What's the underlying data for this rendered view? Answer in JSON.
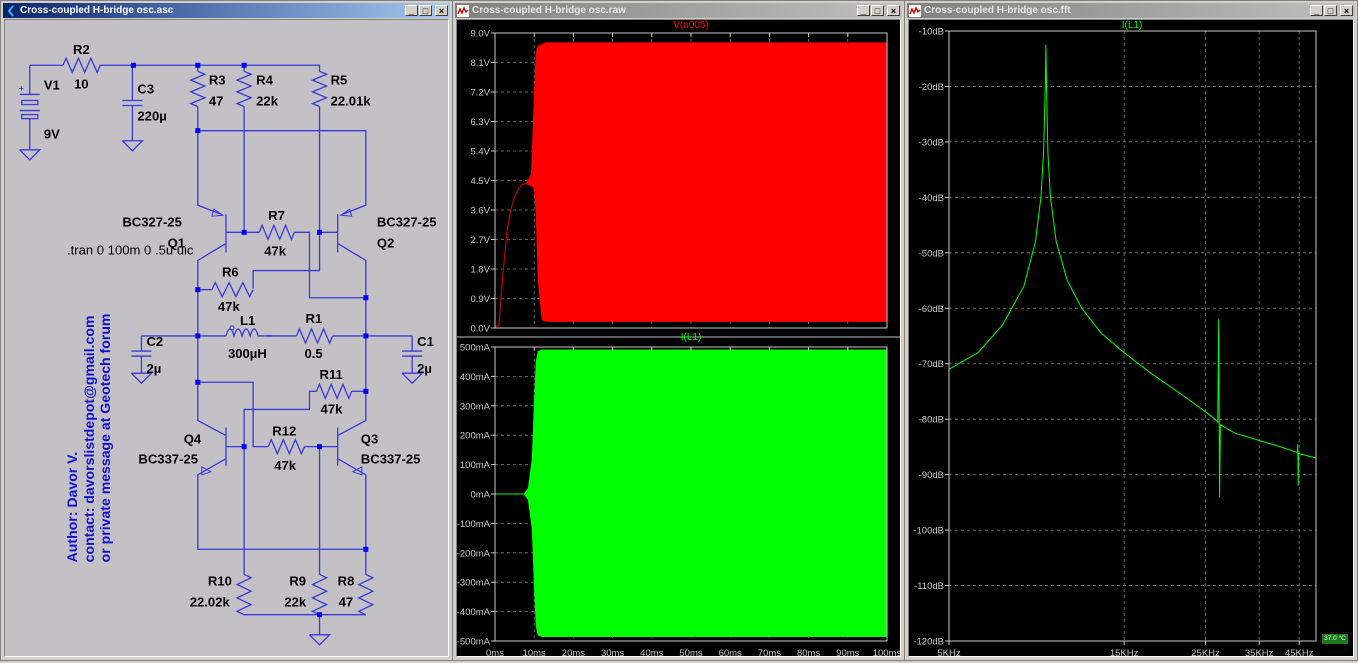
{
  "windows": {
    "schematic": {
      "title": "Cross-coupled H-bridge osc.asc"
    },
    "transient": {
      "title": "Cross-coupled H-bridge osc.raw"
    },
    "fft": {
      "title": "Cross-coupled H-bridge osc.fft"
    }
  },
  "title_buttons": {
    "minimize": "_",
    "maximize": "□",
    "close": "×"
  },
  "schematic": {
    "R2": {
      "name": "R2",
      "value": "10"
    },
    "V1": {
      "name": "V1",
      "value": "9V"
    },
    "C3": {
      "name": "C3",
      "value": "220µ"
    },
    "R3": {
      "name": "R3",
      "value": "47"
    },
    "R4": {
      "name": "R4",
      "value": "22k"
    },
    "R5": {
      "name": "R5",
      "value": "22.01k"
    },
    "Q1": {
      "name": "Q1",
      "model": "BC327-25"
    },
    "Q2": {
      "name": "Q2",
      "model": "BC327-25"
    },
    "R7": {
      "name": "R7",
      "value": "47k"
    },
    "R6": {
      "name": "R6",
      "value": "47k"
    },
    "directive": ".tran 0 100m 0 .5u uic",
    "L1": {
      "name": "L1",
      "value": "300µH"
    },
    "R1": {
      "name": "R1",
      "value": "0.5"
    },
    "C2": {
      "name": "C2",
      "value": "2µ"
    },
    "C1": {
      "name": "C1",
      "value": "2µ"
    },
    "R11": {
      "name": "R11",
      "value": "47k"
    },
    "R12": {
      "name": "R12",
      "value": "47k"
    },
    "Q4": {
      "name": "Q4",
      "model": "BC337-25"
    },
    "Q3": {
      "name": "Q3",
      "model": "BC337-25"
    },
    "R10": {
      "name": "R10",
      "value": "22.02k"
    },
    "R9": {
      "name": "R9",
      "value": "22k"
    },
    "R8": {
      "name": "R8",
      "value": "47"
    },
    "comment": [
      "Author: Davor V.",
      "contact: davorslistdepot@gmail.com",
      "or private message at Geotech forum"
    ],
    "wire_color": "#3a3ad8"
  },
  "status_badge": "37.0 °C",
  "chart_data": [
    {
      "type": "area",
      "title": "V(n005)",
      "color": "#ff0000",
      "xlim": [
        0,
        100
      ],
      "ylim": [
        0,
        9
      ],
      "xticks": [
        "0ms",
        "10ms",
        "20ms",
        "30ms",
        "40ms",
        "50ms",
        "60ms",
        "70ms",
        "80ms",
        "90ms",
        "100ms"
      ],
      "yticks": [
        "0.0V",
        "0.9V",
        "1.8V",
        "2.7V",
        "3.6V",
        "4.5V",
        "5.4V",
        "6.3V",
        "7.2V",
        "8.1V",
        "9.0V"
      ],
      "startup_line": [
        [
          0,
          0
        ],
        [
          1,
          0.1
        ],
        [
          2,
          1.6
        ],
        [
          3,
          2.9
        ],
        [
          4,
          3.6
        ],
        [
          5,
          4.0
        ],
        [
          6,
          4.25
        ],
        [
          7,
          4.38
        ],
        [
          8,
          4.4
        ]
      ],
      "upper_envelope": [
        [
          8,
          4.4
        ],
        [
          9.3,
          4.7
        ],
        [
          10,
          7.0
        ],
        [
          10.5,
          8.4
        ],
        [
          11,
          8.6
        ],
        [
          13,
          8.7
        ],
        [
          100,
          8.7
        ]
      ],
      "lower_envelope": [
        [
          8,
          4.4
        ],
        [
          9,
          4.35
        ],
        [
          10,
          4.3
        ],
        [
          10.5,
          3.5
        ],
        [
          11,
          1.5
        ],
        [
          12,
          0.25
        ],
        [
          13,
          0.2
        ],
        [
          100,
          0.2
        ]
      ]
    },
    {
      "type": "area",
      "title": "I(L1)",
      "color": "#00ff00",
      "xlim": [
        0,
        100
      ],
      "ylim": [
        -500,
        500
      ],
      "xticks": [
        "0ms",
        "10ms",
        "20ms",
        "30ms",
        "40ms",
        "50ms",
        "60ms",
        "70ms",
        "80ms",
        "90ms",
        "100ms"
      ],
      "yticks": [
        "-500mA",
        "-400mA",
        "-300mA",
        "-200mA",
        "-100mA",
        "0mA",
        "100mA",
        "200mA",
        "300mA",
        "400mA",
        "500mA"
      ],
      "upper_envelope": [
        [
          0,
          0
        ],
        [
          7.5,
          0
        ],
        [
          8.5,
          20
        ],
        [
          9.5,
          120
        ],
        [
          10,
          300
        ],
        [
          10.5,
          450
        ],
        [
          11,
          485
        ],
        [
          12,
          490
        ],
        [
          100,
          490
        ]
      ],
      "lower_envelope": [
        [
          0,
          0
        ],
        [
          7.5,
          0
        ],
        [
          8.5,
          -20
        ],
        [
          9.5,
          -120
        ],
        [
          10,
          -300
        ],
        [
          10.5,
          -450
        ],
        [
          11,
          -480
        ],
        [
          12,
          -485
        ],
        [
          100,
          -485
        ]
      ]
    },
    {
      "type": "line",
      "title": "I(L1)",
      "color": "#00ff00",
      "xscale": "log",
      "xlim": [
        5,
        50
      ],
      "ylim": [
        -120,
        -10
      ],
      "xticks": [
        {
          "v": 5,
          "label": "5KHz"
        },
        {
          "v": 15,
          "label": "15KHz"
        },
        {
          "v": 25,
          "label": "25KHz"
        },
        {
          "v": 35,
          "label": "35KHz"
        },
        {
          "v": 45,
          "label": "45KHz"
        }
      ],
      "yticks": [
        "-120dB",
        "-110dB",
        "-100dB",
        "-90dB",
        "-80dB",
        "-70dB",
        "-60dB",
        "-50dB",
        "-40dB",
        "-30dB",
        "-20dB",
        "-10dB"
      ],
      "points": [
        [
          5,
          -71
        ],
        [
          6,
          -68
        ],
        [
          7,
          -63
        ],
        [
          8,
          -56
        ],
        [
          8.6,
          -48
        ],
        [
          8.9,
          -40
        ],
        [
          9.05,
          -32
        ],
        [
          9.15,
          -20
        ],
        [
          9.18,
          -12.5
        ],
        [
          9.22,
          -20
        ],
        [
          9.3,
          -32
        ],
        [
          9.45,
          -40
        ],
        [
          9.8,
          -48
        ],
        [
          10.5,
          -55
        ],
        [
          11.5,
          -60
        ],
        [
          13,
          -64.5
        ],
        [
          15,
          -68
        ],
        [
          18,
          -72
        ],
        [
          22,
          -76
        ],
        [
          26,
          -79.5
        ],
        [
          27.0,
          -80.5
        ],
        [
          27.15,
          -62
        ],
        [
          27.3,
          -94
        ],
        [
          27.45,
          -81
        ],
        [
          30,
          -82.5
        ],
        [
          40,
          -85
        ],
        [
          44.5,
          -86
        ],
        [
          44.6,
          -84.5
        ],
        [
          44.7,
          -92
        ],
        [
          44.8,
          -86.2
        ],
        [
          50,
          -87
        ]
      ]
    }
  ]
}
